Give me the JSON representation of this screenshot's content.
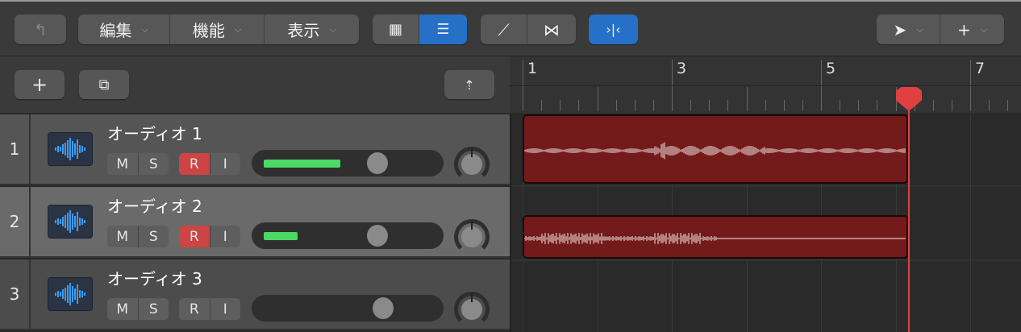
{
  "toolbar": {
    "menus": [
      {
        "label": "編集"
      },
      {
        "label": "機能"
      },
      {
        "label": "表示"
      }
    ]
  },
  "ruler": {
    "bars": [
      "1",
      "3",
      "5",
      "7"
    ]
  },
  "tracks": [
    {
      "number": "1",
      "name": "オーディオ 1",
      "mute": "M",
      "solo": "S",
      "record": "R",
      "input": "I",
      "record_on": true,
      "volume_meter": 0.45,
      "fader": 0.6
    },
    {
      "number": "2",
      "name": "オーディオ 2",
      "mute": "M",
      "solo": "S",
      "record": "R",
      "input": "I",
      "record_on": true,
      "volume_meter": 0.2,
      "fader": 0.6
    },
    {
      "number": "3",
      "name": "オーディオ 3",
      "mute": "M",
      "solo": "S",
      "record": "R",
      "input": "I",
      "record_on": false,
      "volume_meter": 0,
      "fader": 0.63
    }
  ],
  "colors": {
    "accent": "#2670c8",
    "region": "#731a1a",
    "playhead": "#e04040",
    "meter": "#4cd964"
  }
}
